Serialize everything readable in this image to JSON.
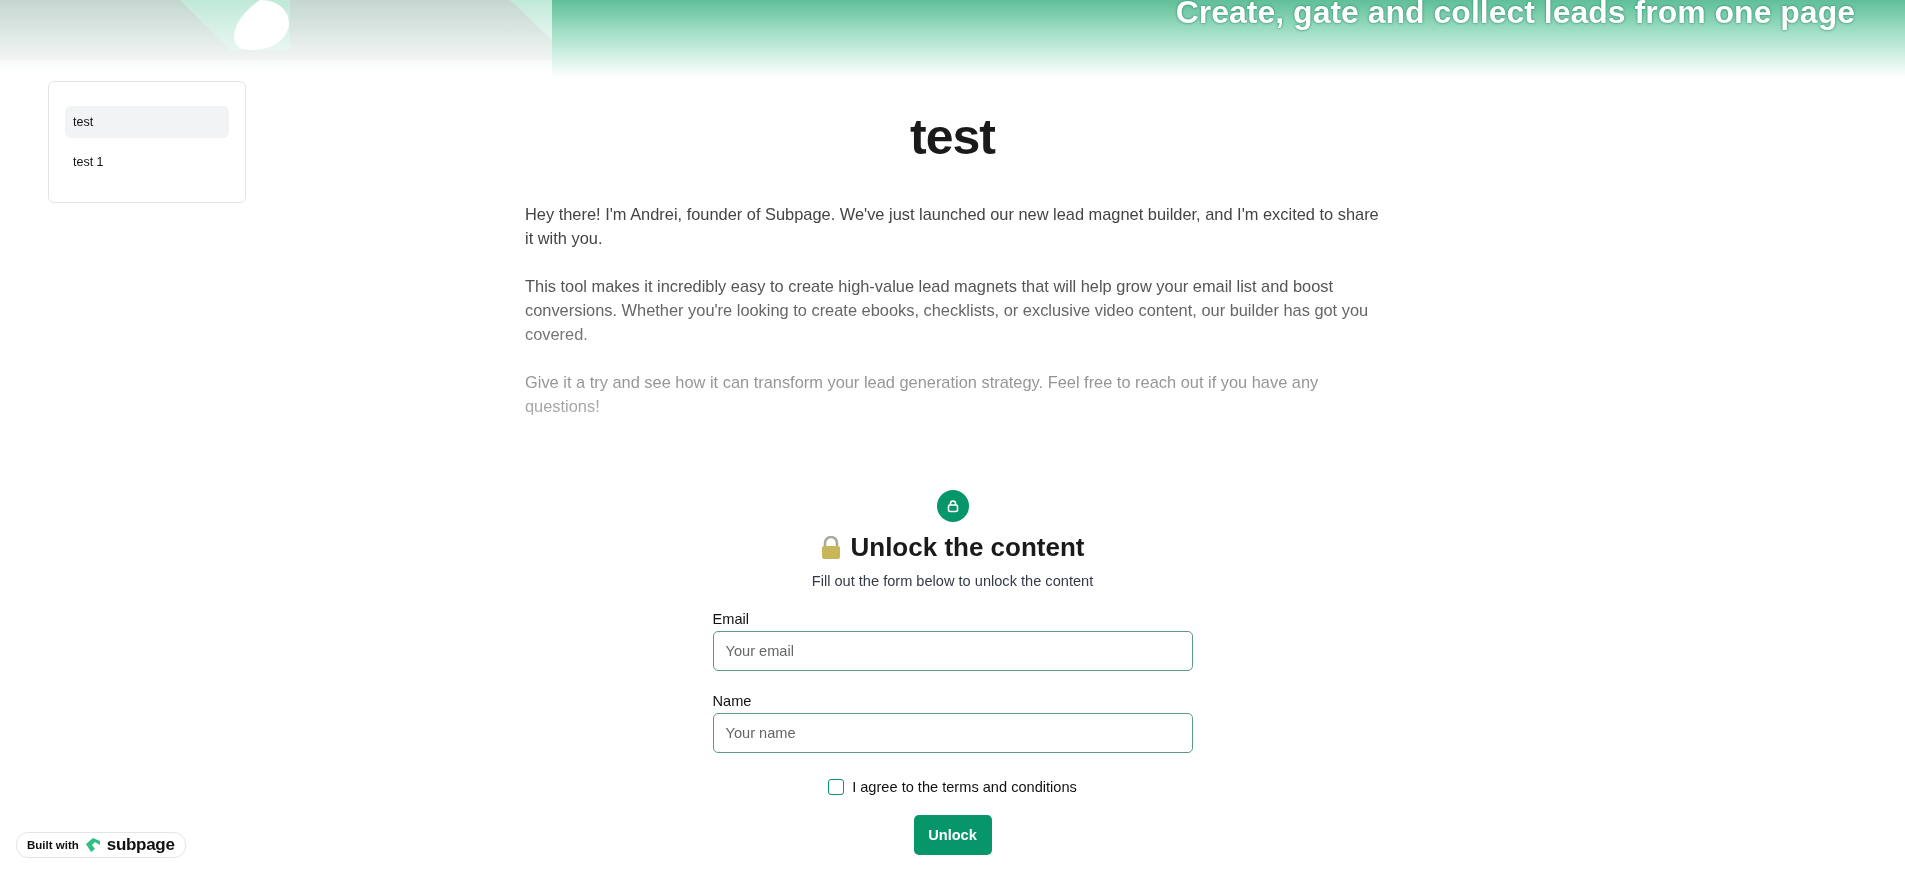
{
  "banner": {
    "heading": "Create, gate and collect leads from one page"
  },
  "sidebar": {
    "items": [
      {
        "label": "test",
        "selected": true
      },
      {
        "label": "test 1",
        "selected": false
      }
    ]
  },
  "article": {
    "title": "test",
    "paragraphs": [
      "Hey there! I'm Andrei, founder of Subpage. We've just launched our new lead magnet builder, and I'm excited to share it with you.",
      "This tool makes it incredibly easy to create high-value lead magnets that will help grow your email list and boost conversions. Whether you're looking to create ebooks, checklists, or exclusive video content, our builder has got you covered.",
      "Give it a try and see how it can transform your lead generation strategy. Feel free to reach out if you have any questions!"
    ]
  },
  "gate": {
    "title": "Unlock the content",
    "subtitle": "Fill out the form below to unlock the content",
    "fields": [
      {
        "label": "Email",
        "placeholder": "Your email"
      },
      {
        "label": "Name",
        "placeholder": "Your name"
      }
    ],
    "consent": {
      "label": "I agree to the terms and conditions",
      "checked": false
    },
    "button": "Unlock"
  },
  "badge": {
    "prefix": "Built with",
    "brand": "subpage"
  }
}
